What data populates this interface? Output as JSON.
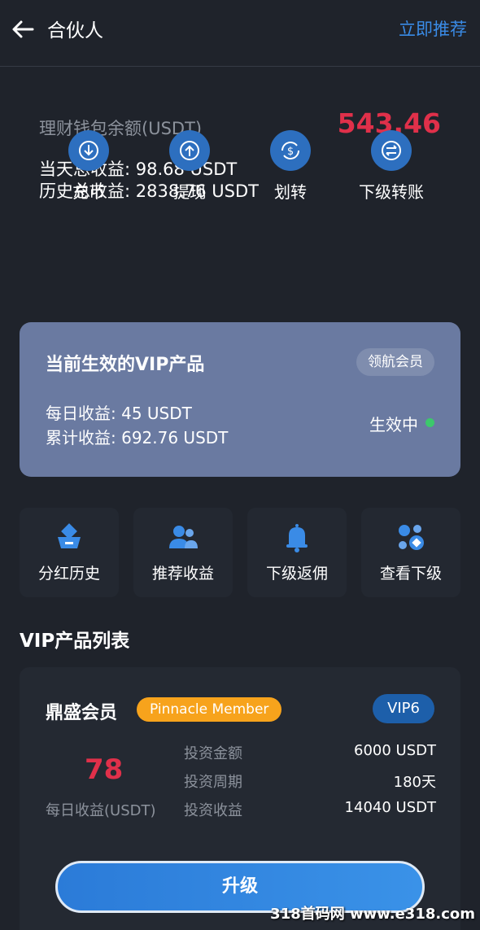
{
  "header": {
    "title": "合伙人",
    "action": "立即推荐"
  },
  "wallet": {
    "label": "理财钱包余额(USDT)",
    "balance": "543.46",
    "today_earnings": "当天总收益: 98.68 USDT",
    "total_earnings": "历史总收益: 2838.76 USDT"
  },
  "actions": [
    {
      "label": "充币",
      "icon": "deposit-icon"
    },
    {
      "label": "提现",
      "icon": "withdraw-icon"
    },
    {
      "label": "划转",
      "icon": "transfer-icon"
    },
    {
      "label": "下级转账",
      "icon": "sub-transfer-icon"
    }
  ],
  "vip_active": {
    "title": "当前生效的VIP产品",
    "badge": "领航会员",
    "daily": "每日收益: 45 USDT",
    "total": "累计收益: 692.76 USDT",
    "status": "生效中"
  },
  "menu": [
    {
      "label": "分红历史",
      "icon": "dividend-history-icon"
    },
    {
      "label": "推荐收益",
      "icon": "referral-earnings-icon"
    },
    {
      "label": "下级返佣",
      "icon": "bell-icon"
    },
    {
      "label": "查看下级",
      "icon": "view-subordinates-icon"
    }
  ],
  "list_title": "VIP产品列表",
  "product": {
    "name": "鼎盛会员",
    "tag": "Pinnacle Member",
    "level": "VIP6",
    "daily_value": "78",
    "daily_label": "每日收益(USDT)",
    "rows": [
      {
        "key": "投资金额",
        "value": "6000 USDT"
      },
      {
        "key": "投资周期",
        "value": "180天"
      },
      {
        "key": "投资收益",
        "value": "14040 USDT"
      }
    ],
    "button": "升级"
  },
  "watermark": "318首码网 www.e318.com",
  "colors": {
    "background": "#1f232b",
    "accent": "#2d6fbf",
    "balance_red": "#e0304a",
    "vip_card": "#6a7aa1",
    "tag_orange": "#f7a31c",
    "status_green": "#3cc86b"
  }
}
